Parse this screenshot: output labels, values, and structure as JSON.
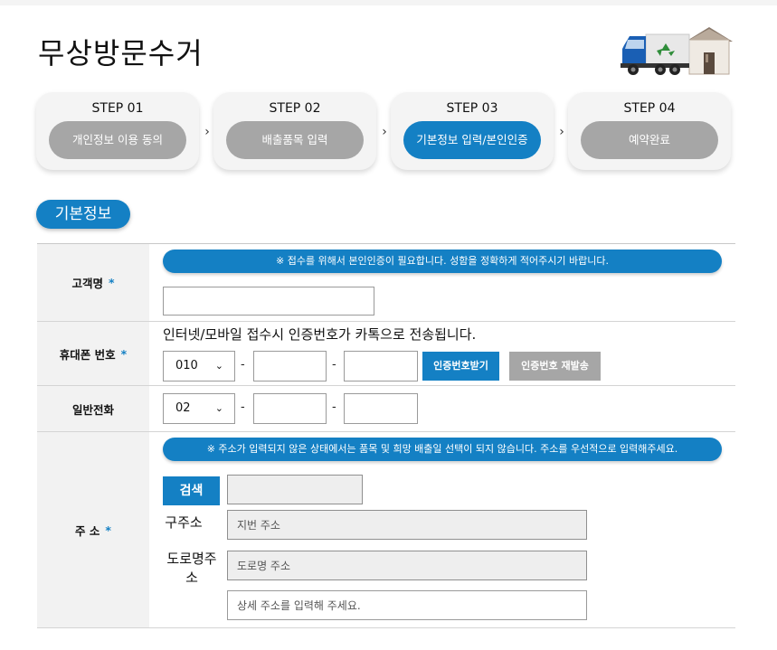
{
  "page": {
    "title": "무상방문수거"
  },
  "steps": [
    {
      "num": "STEP 01",
      "label": "개인정보 이용 동의",
      "active": false
    },
    {
      "num": "STEP 02",
      "label": "배출품목 입력",
      "active": false
    },
    {
      "num": "STEP 03",
      "label": "기본정보 입력/본인인증",
      "active": true
    },
    {
      "num": "STEP 04",
      "label": "예약완료",
      "active": false
    }
  ],
  "step_arrow": "›",
  "section": {
    "title": "기본정보"
  },
  "form": {
    "required_mark": "*",
    "name": {
      "label": "고객명",
      "notice": "※ 접수를 위해서 본인인증이 필요합니다. 성함을 정확하게 적어주시기 바랍니다.",
      "value": ""
    },
    "mobile": {
      "label": "휴대폰 번호",
      "info": "인터넷/모바일 접수시 인증번호가 카톡으로 전송됩니다.",
      "prefix": "010",
      "dash": "-",
      "send_button": "인증번호받기",
      "resend_button": "인증번호 재발송"
    },
    "phone": {
      "label": "일반전화",
      "prefix": "02",
      "dash": "-"
    },
    "address": {
      "label": "주 소",
      "notice": "※ 주소가 입력되지 않은 상태에서는 품목 및 희망 배출일 선택이 되지 않습니다. 주소를 우선적으로 입력해주세요.",
      "search_button": "검색",
      "old_label": "구주소",
      "old_placeholder": "지번 주소",
      "road_label_1": "도로명주",
      "road_label_2": "소",
      "road_placeholder": "도로명 주소",
      "detail_placeholder": "상세 주소를 입력해 주세요."
    }
  },
  "icons": {
    "chevron": "⌄"
  },
  "colors": {
    "accent": "#1480c4",
    "inactive": "#a6a6a6"
  }
}
